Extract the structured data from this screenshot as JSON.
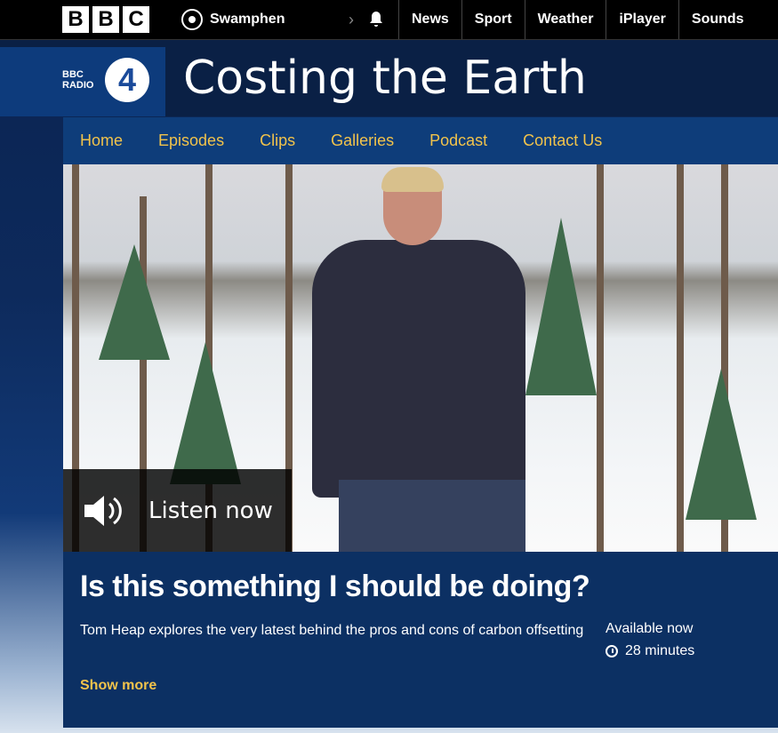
{
  "header": {
    "logo_letters": [
      "B",
      "B",
      "C"
    ],
    "account_name": "Swamphen",
    "nav": [
      "News",
      "Sport",
      "Weather",
      "iPlayer",
      "Sounds"
    ]
  },
  "brand": {
    "station_small": "BBC RADIO",
    "station_number": "4",
    "programme_title": "Costing the Earth"
  },
  "subnav": [
    "Home",
    "Episodes",
    "Clips",
    "Galleries",
    "Podcast",
    "Contact Us"
  ],
  "hero": {
    "listen_label": "Listen now"
  },
  "episode": {
    "title": "Is this something I should be doing?",
    "description": "Tom Heap explores the very latest behind the pros and cons of carbon offsetting",
    "availability": "Available now",
    "duration": "28 minutes",
    "show_more": "Show more"
  },
  "colors": {
    "accent": "#f1c34b",
    "navy": "#0c3063",
    "nav_blue": "#0e3d7a"
  }
}
